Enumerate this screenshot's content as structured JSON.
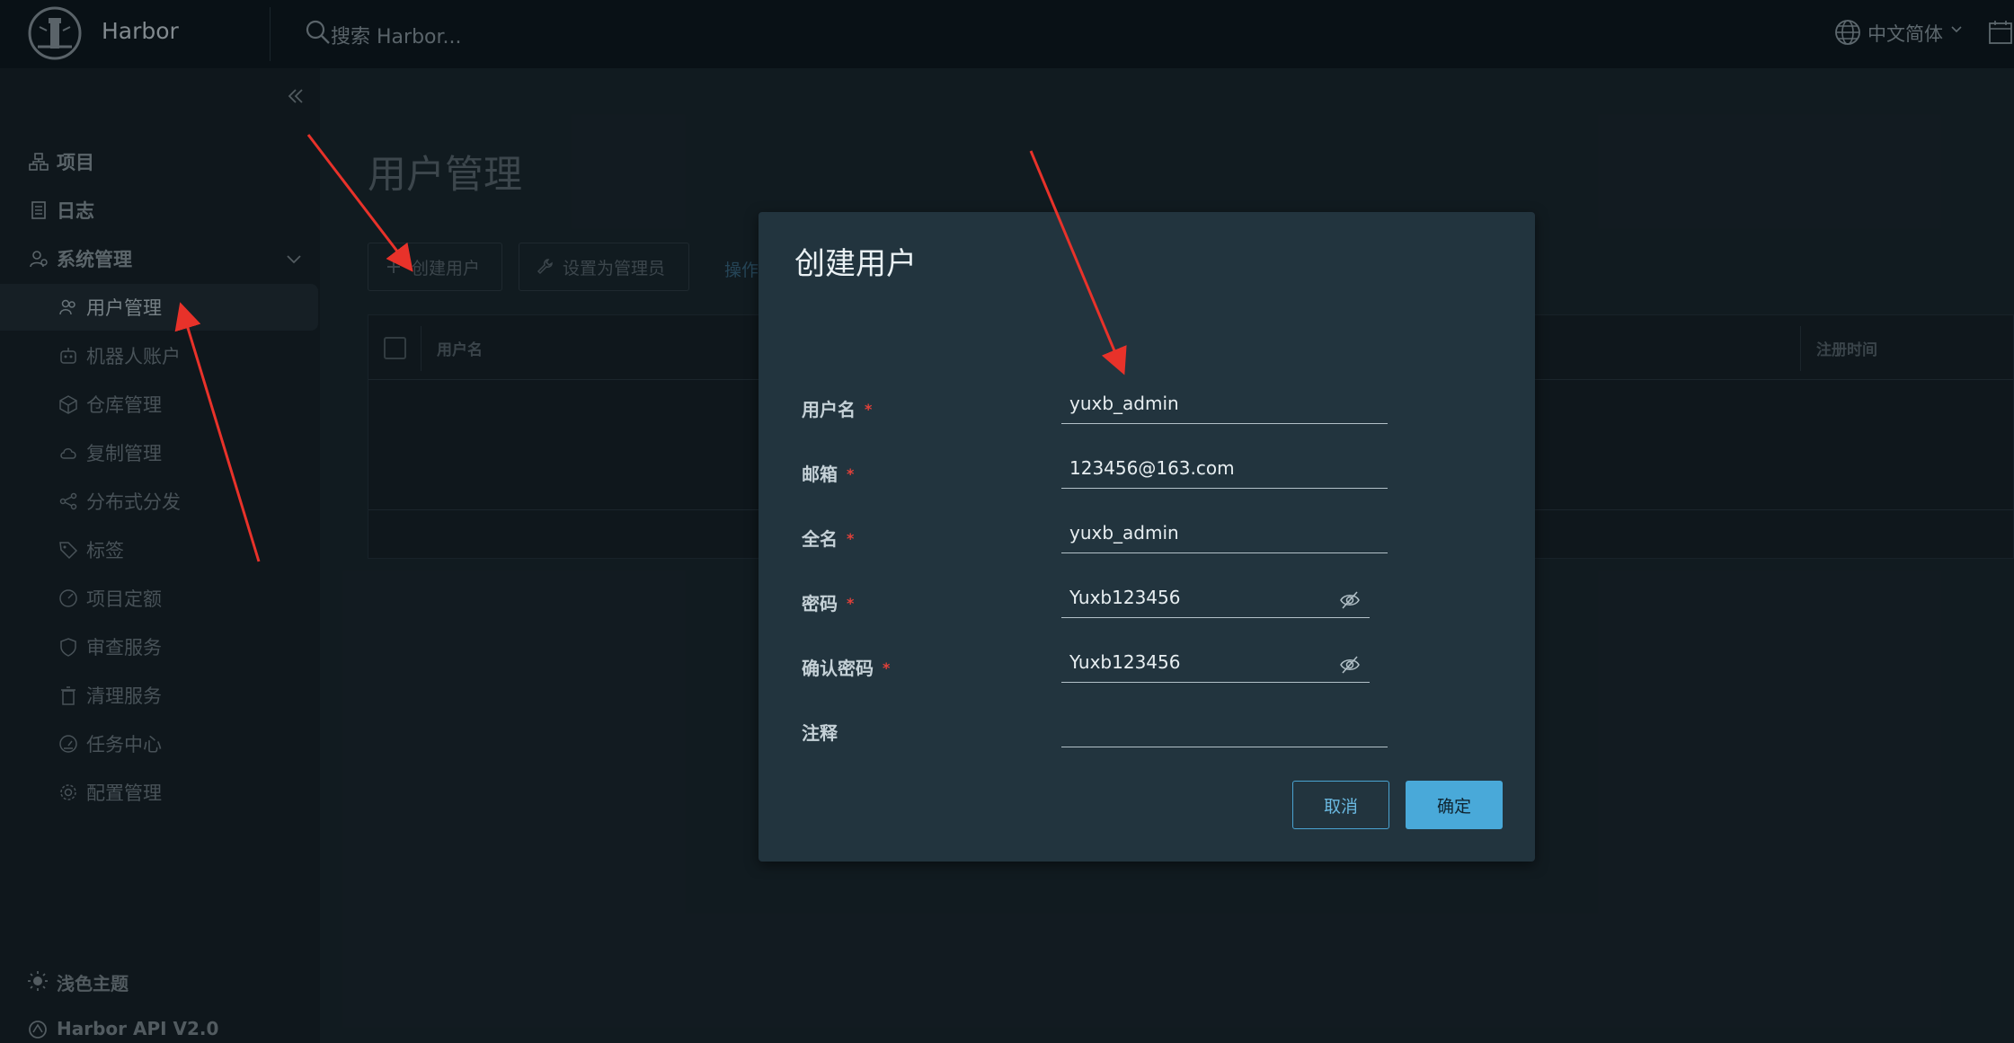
{
  "header": {
    "brand": "Harbor",
    "search_placeholder": "搜索 Harbor...",
    "language": "中文简体"
  },
  "sidebar": {
    "top_items": [
      {
        "label": "项目",
        "icon": "project-icon"
      },
      {
        "label": "日志",
        "icon": "log-icon"
      },
      {
        "label": "系统管理",
        "icon": "admin-icon"
      }
    ],
    "sub_items": [
      {
        "label": "用户管理",
        "icon": "users-icon",
        "active": true
      },
      {
        "label": "机器人账户",
        "icon": "robot-icon"
      },
      {
        "label": "仓库管理",
        "icon": "box-icon"
      },
      {
        "label": "复制管理",
        "icon": "cloud-icon"
      },
      {
        "label": "分布式分发",
        "icon": "share-icon"
      },
      {
        "label": "标签",
        "icon": "tag-icon"
      },
      {
        "label": "项目定额",
        "icon": "quota-icon"
      },
      {
        "label": "审查服务",
        "icon": "shield-icon"
      },
      {
        "label": "清理服务",
        "icon": "trash-icon"
      },
      {
        "label": "任务中心",
        "icon": "dashboard-icon"
      },
      {
        "label": "配置管理",
        "icon": "gear-icon"
      }
    ],
    "footer": {
      "theme": "浅色主题",
      "api": "Harbor API V2.0"
    }
  },
  "main": {
    "title": "用户管理",
    "toolbar": {
      "create_user": "创建用户",
      "set_admin": "设置为管理员",
      "operations": "操作"
    },
    "grid": {
      "columns": [
        "用户名",
        "注册时间"
      ]
    }
  },
  "modal": {
    "title": "创建用户",
    "fields": [
      {
        "label": "用户名",
        "value": "yuxb_admin",
        "required": true
      },
      {
        "label": "邮箱",
        "value": "123456@163.com",
        "required": true
      },
      {
        "label": "全名",
        "value": "yuxb_admin",
        "required": true
      },
      {
        "label": "密码",
        "value": "Yuxb123456",
        "required": true
      },
      {
        "label": "确认密码",
        "value": "Yuxb123456",
        "required": true
      },
      {
        "label": "注释",
        "value": "",
        "required": false
      }
    ],
    "required_mark": "*",
    "cancel": "取消",
    "confirm": "确定"
  },
  "colors": {
    "primary": "#49a9d9",
    "required": "#e0413a",
    "annotation_arrow": "#e8322a"
  }
}
